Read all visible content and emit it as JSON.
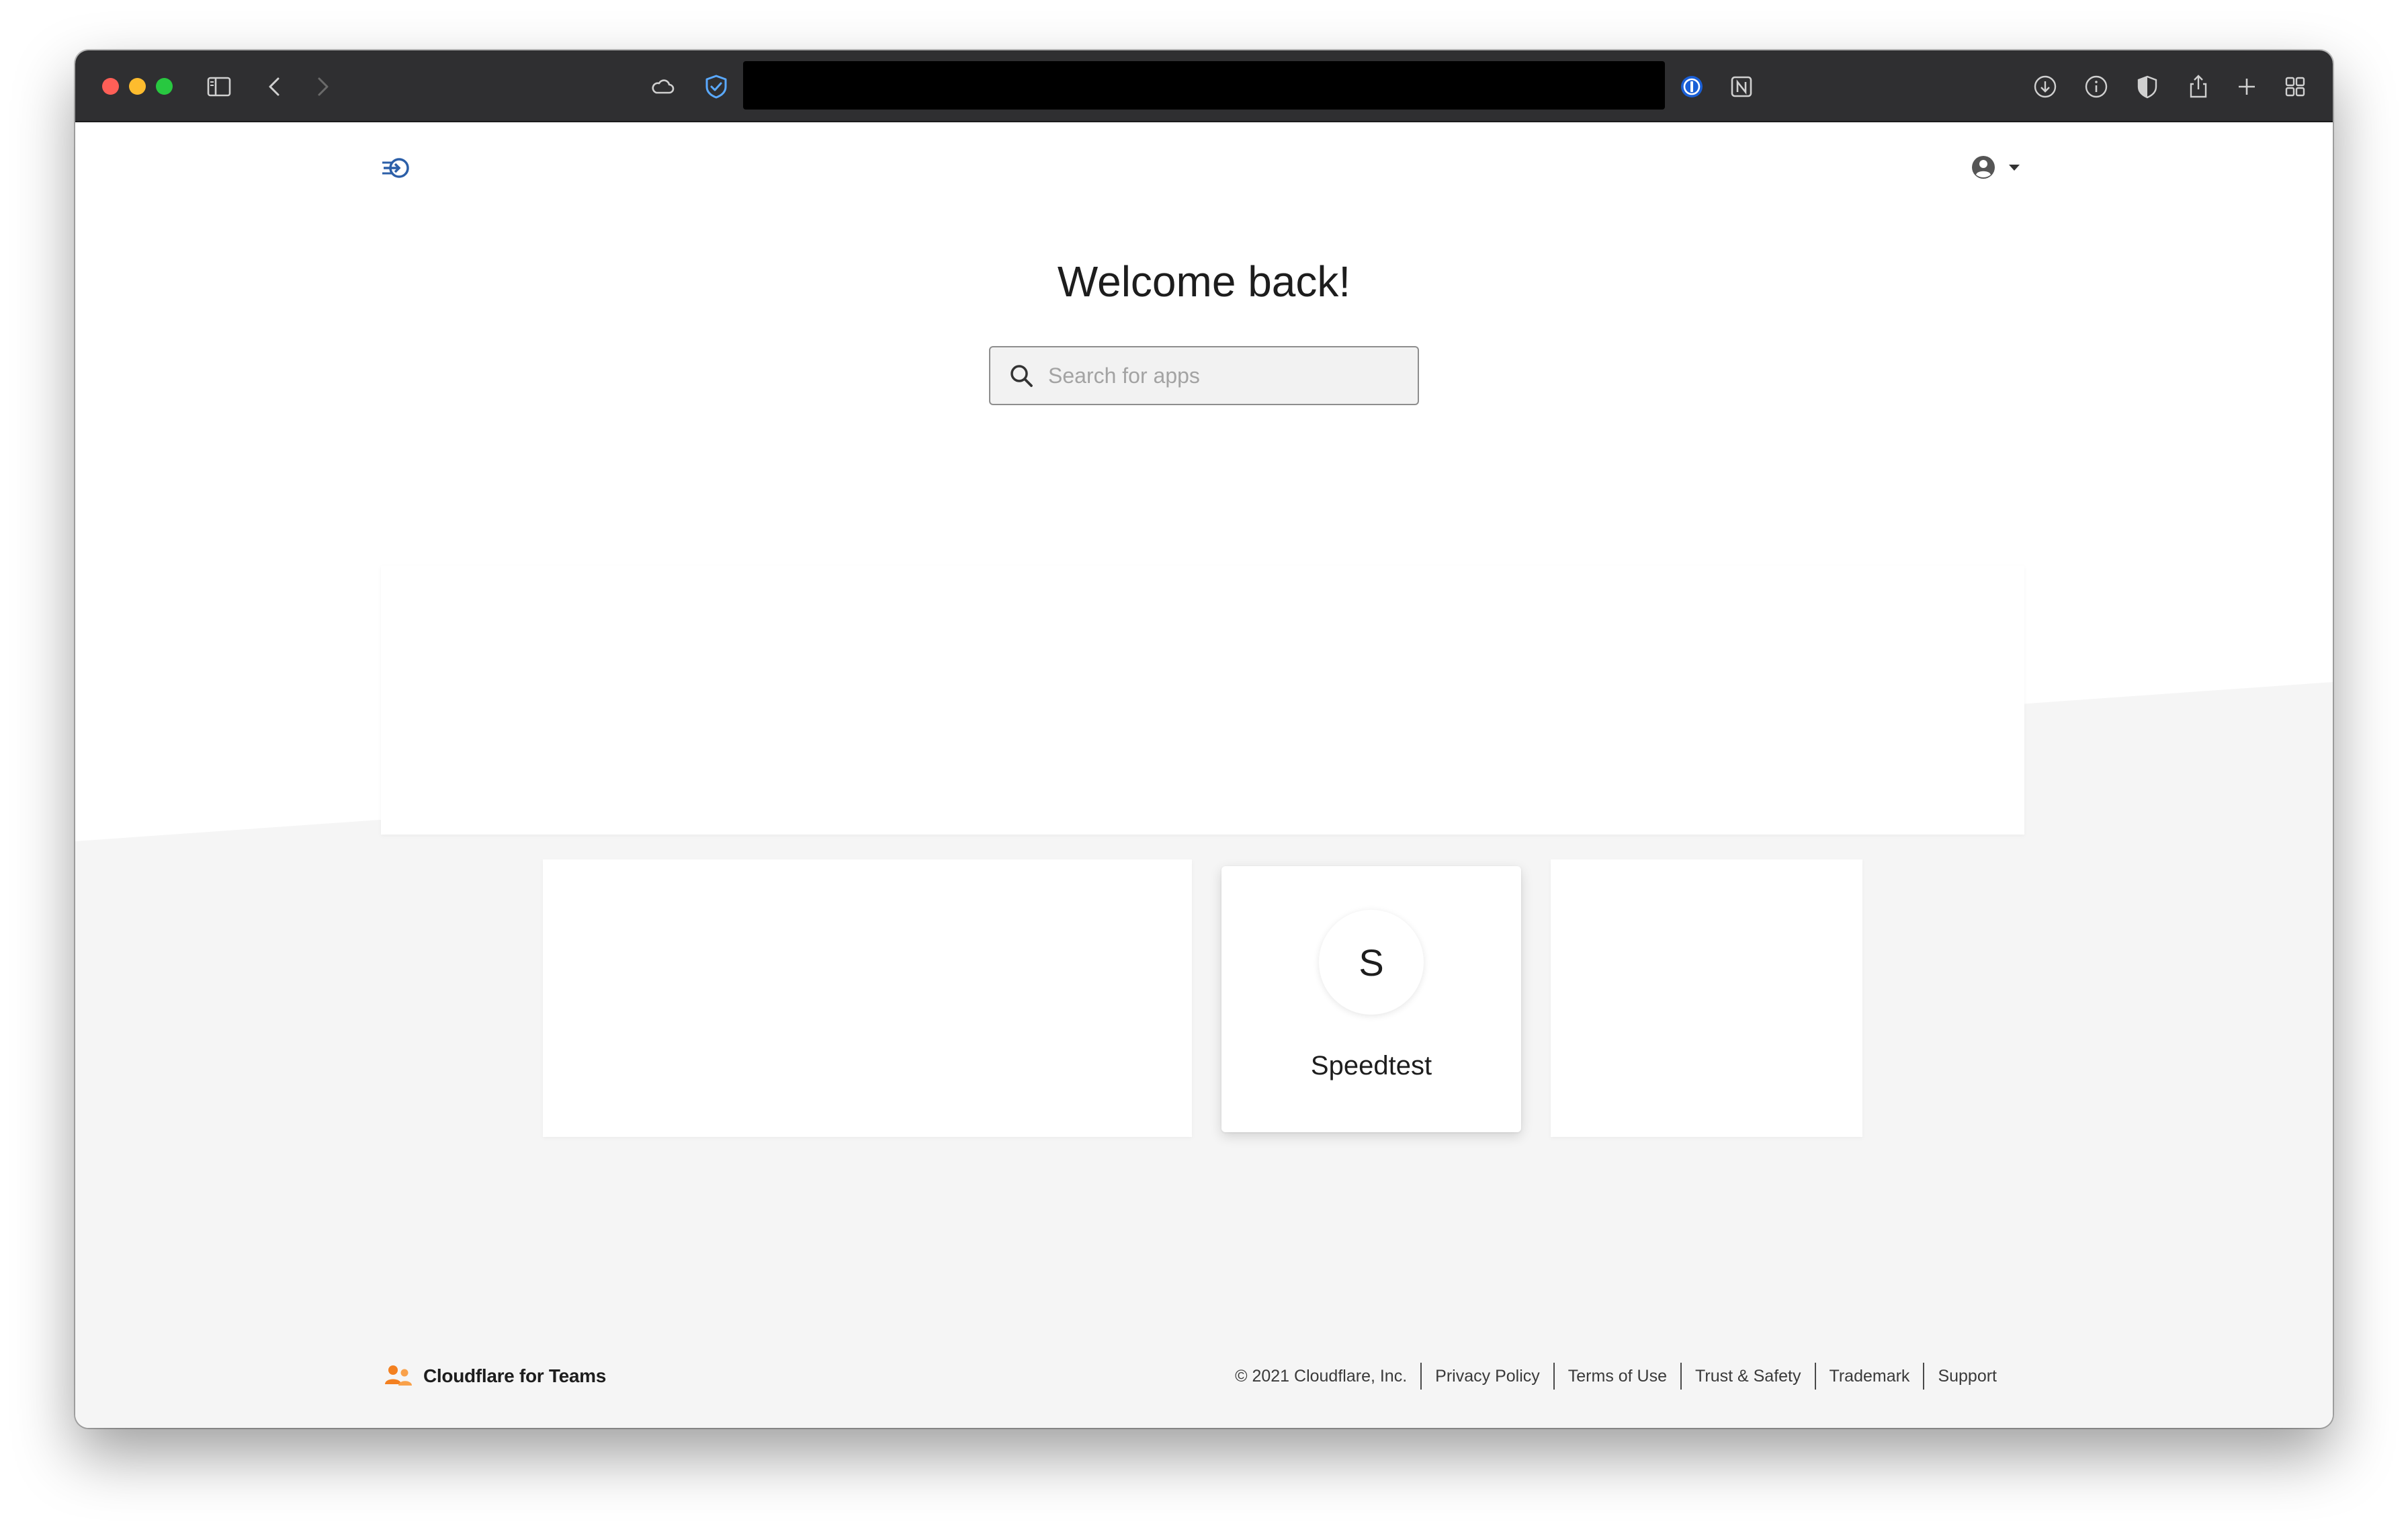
{
  "browser": {
    "icons": [
      "sidebar-icon",
      "back-icon",
      "forward-icon",
      "icloud-icon",
      "bitwarden-icon",
      "onepassword-icon",
      "notion-icon",
      "downloads-icon",
      "info-icon",
      "shield-icon",
      "share-icon",
      "new-tab-icon",
      "tab-overview-icon"
    ]
  },
  "header": {
    "logo_icon": "cloudflare-access-logo",
    "user_icon": "user-circle-icon",
    "dropdown_icon": "caret-down-icon"
  },
  "main": {
    "title": "Welcome back!",
    "search": {
      "placeholder": "Search for apps",
      "value": ""
    }
  },
  "apps": [
    {
      "initial": "S",
      "name": "Speedtest"
    }
  ],
  "footer": {
    "brand": "Cloudflare for Teams",
    "copyright": "© 2021 Cloudflare, Inc.",
    "links": [
      "Privacy Policy",
      "Terms of Use",
      "Trust & Safety",
      "Trademark",
      "Support"
    ]
  },
  "colors": {
    "accent": "#2c5fa8",
    "brand_orange": "#f38020",
    "toolbar_bg": "#2f2f31"
  }
}
